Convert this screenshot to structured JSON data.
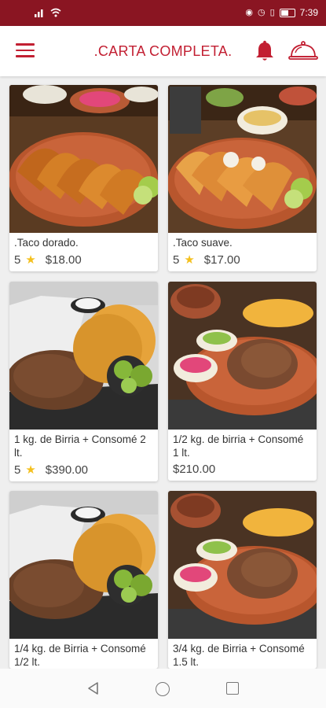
{
  "status_bar": {
    "left_icons": [
      "signal-icon",
      "wifi-icon"
    ],
    "right_icons": [
      "nfc-icon",
      "alarm-icon",
      "vibrate-icon",
      "battery-icon"
    ],
    "time": "7:39"
  },
  "header": {
    "title": ".CARTA COMPLETA.",
    "accent_color": "#c21f32",
    "status_bar_color": "#8a1522"
  },
  "products": [
    {
      "name": ".Taco dorado.",
      "rating": "5",
      "price": "$18.00"
    },
    {
      "name": ".Taco suave.",
      "rating": "5",
      "price": "$17.00"
    },
    {
      "name": "1 kg. de Birria + Consomé 2 lt.",
      "rating": "5",
      "price": "$390.00"
    },
    {
      "name": "1/2 kg. de birria + Consomé 1 lt.",
      "rating": "",
      "price": "$210.00"
    },
    {
      "name": "1/4 kg. de Birria + Consomé 1/2 lt.",
      "rating": "",
      "price": ""
    },
    {
      "name": "3/4 kg. de Birria + Consomé 1.5 lt.",
      "rating": "",
      "price": ""
    }
  ],
  "nav_bar": {
    "icons": [
      "back-icon",
      "home-icon",
      "recents-icon"
    ]
  }
}
